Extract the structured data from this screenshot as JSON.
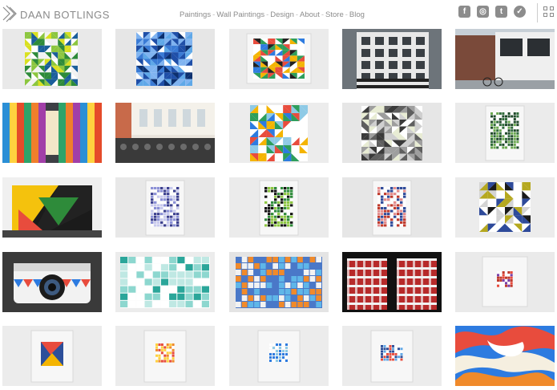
{
  "site": {
    "logo_text": "DAAN BOTLINGS"
  },
  "nav": {
    "items": [
      "Paintings",
      "Wall Paintings",
      "Design",
      "About",
      "Store",
      "Blog"
    ],
    "separator": "-"
  },
  "social": {
    "icons": [
      {
        "name": "facebook-icon",
        "glyph": "f"
      },
      {
        "name": "instagram-icon",
        "glyph": "◎"
      },
      {
        "name": "tumblr-icon",
        "glyph": "t"
      },
      {
        "name": "twitter-icon",
        "glyph": "✓"
      }
    ]
  },
  "gallery": {
    "thumbs": [
      {
        "name": "thumb-green-triangles-canvas"
      },
      {
        "name": "thumb-blue-triangles-canvas"
      },
      {
        "name": "thumb-multicolor-triangles-framed"
      },
      {
        "name": "thumb-building-corner-photo"
      },
      {
        "name": "thumb-street-storefront-photo"
      },
      {
        "name": "thumb-colored-hallway-photo"
      },
      {
        "name": "thumb-gallery-interior-photo"
      },
      {
        "name": "thumb-grid-triangles-canvas"
      },
      {
        "name": "thumb-grey-triangles-canvas"
      },
      {
        "name": "thumb-green-pattern-framed"
      },
      {
        "name": "thumb-geometric-bag-photo"
      },
      {
        "name": "thumb-purple-pattern-print"
      },
      {
        "name": "thumb-green-pattern-print"
      },
      {
        "name": "thumb-red-pattern-print"
      },
      {
        "name": "thumb-yellow-squares-canvas"
      },
      {
        "name": "thumb-camera-photo"
      },
      {
        "name": "thumb-teal-grid-canvas"
      },
      {
        "name": "thumb-orange-blue-grid-canvas"
      },
      {
        "name": "thumb-plaid-shirts-photo"
      },
      {
        "name": "thumb-small-red-square-framed"
      },
      {
        "name": "thumb-small-collage-framed"
      },
      {
        "name": "thumb-orange-squares-framed"
      },
      {
        "name": "thumb-blue-grid-framed"
      },
      {
        "name": "thumb-blue-pattern-framed"
      },
      {
        "name": "thumb-camouflage-pattern"
      }
    ]
  },
  "colors": {
    "text": "#8c8c8c",
    "background": "#ffffff"
  }
}
